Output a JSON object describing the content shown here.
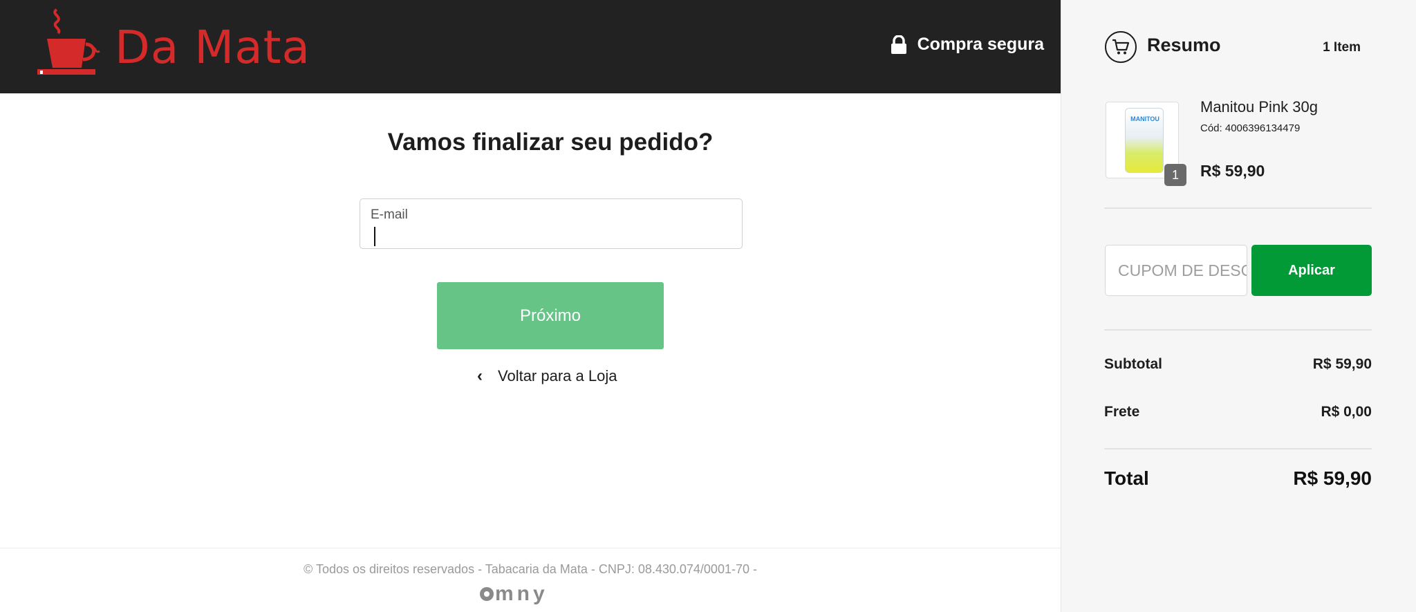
{
  "header": {
    "brand_name": "Da Mata",
    "secure_label": "Compra segura"
  },
  "checkout": {
    "heading": "Vamos finalizar seu pedido?",
    "email_label": "E-mail",
    "email_value": "",
    "next_label": "Próximo",
    "back_label": "Voltar para a Loja"
  },
  "footer": {
    "copyright": "© Todos os direitos reservados - Tabacaria da Mata - CNPJ: 08.430.074/0001-70 -",
    "powered_by": "mny"
  },
  "summary": {
    "title": "Resumo",
    "item_count": "1 Item",
    "product": {
      "name": "Manitou Pink 30g",
      "code": "Cód: 4006396134479",
      "price": "R$ 59,90",
      "quantity": "1",
      "package_text": "MANITOU"
    },
    "coupon_placeholder": "CUPOM DE DESCONTO",
    "apply_label": "Aplicar",
    "subtotal_label": "Subtotal",
    "subtotal_value": "R$ 59,90",
    "shipping_label": "Frete",
    "shipping_value": "R$ 0,00",
    "total_label": "Total",
    "total_value": "R$ 59,90"
  },
  "colors": {
    "header_bg": "#222222",
    "brand_red": "#d42a2a",
    "next_button": "#67c487",
    "apply_button": "#029a36",
    "sidebar_bg": "#f6f6f6"
  }
}
